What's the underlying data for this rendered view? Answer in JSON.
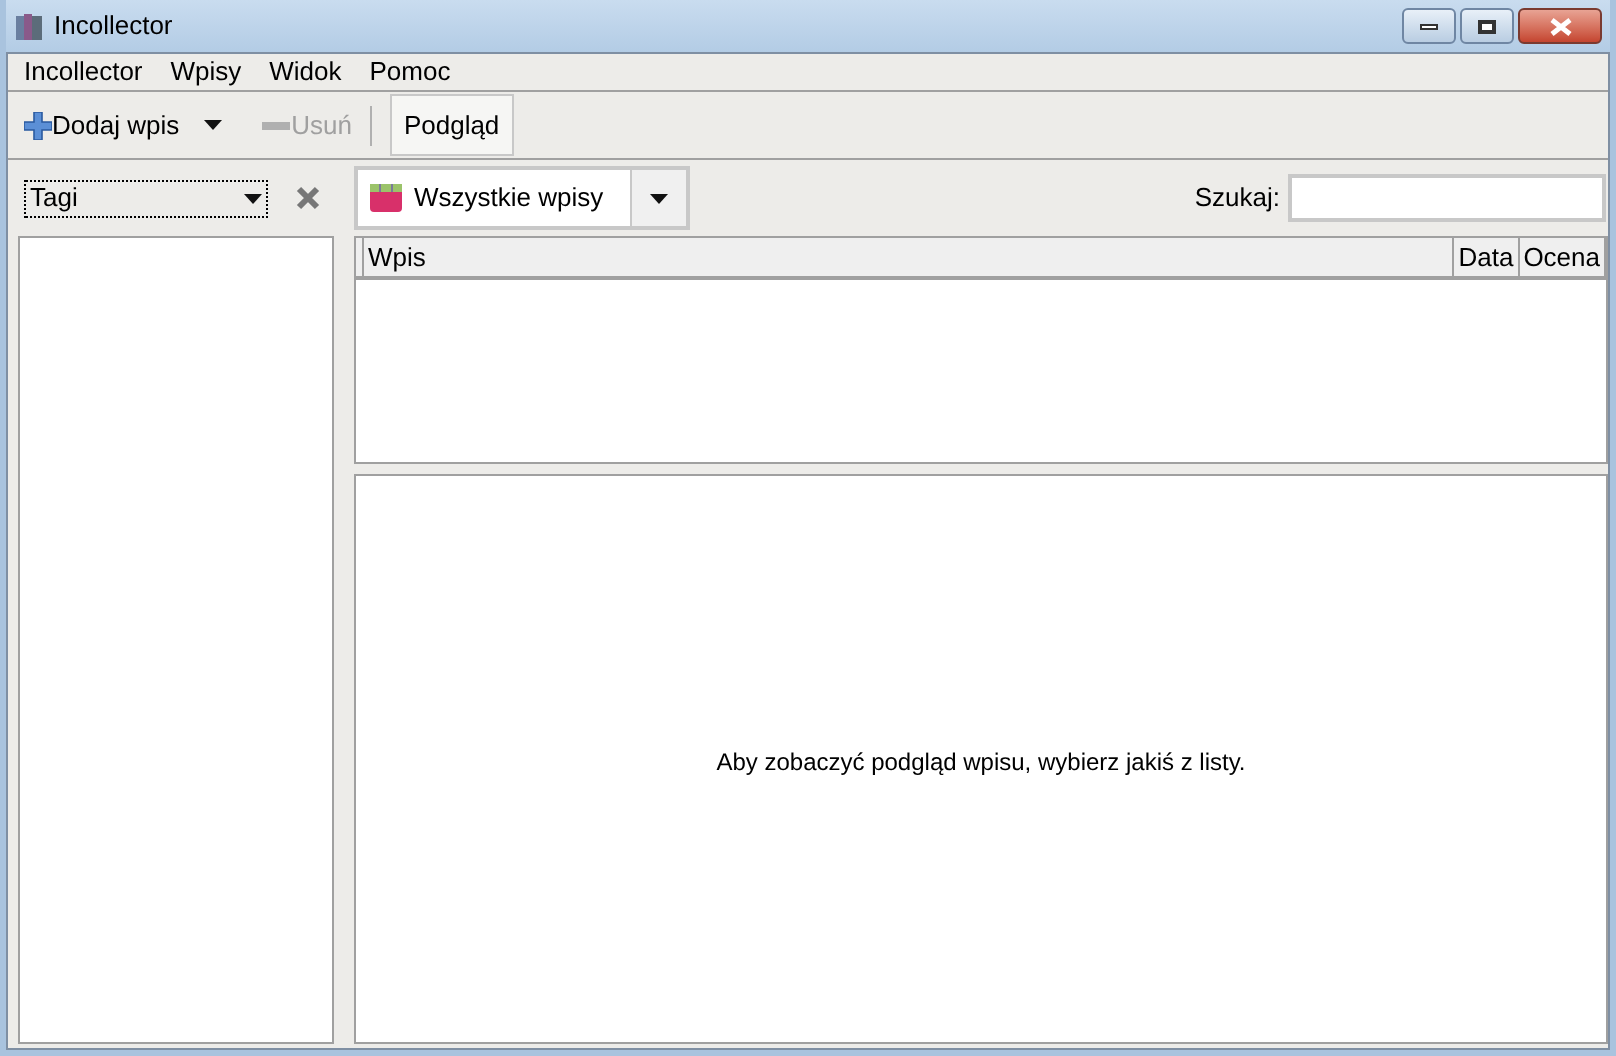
{
  "window": {
    "title": "Incollector"
  },
  "menu": [
    "Incollector",
    "Wpisy",
    "Widok",
    "Pomoc"
  ],
  "toolbar": {
    "add": {
      "label": "Dodaj wpis",
      "disabled": false
    },
    "remove": {
      "label": "Usuń",
      "disabled": true
    },
    "preview": {
      "label": "Podgląd",
      "selected": true
    }
  },
  "sidebar": {
    "filter": "Tagi"
  },
  "category": {
    "value": "Wszystkie wpisy"
  },
  "search": {
    "label": "Szukaj:"
  },
  "table": {
    "columns": [
      "Wpis",
      "Data",
      "Ocena"
    ]
  },
  "preview": {
    "message": "Aby zobaczyć podgląd wpisu, wybierz jakiś z listy."
  }
}
